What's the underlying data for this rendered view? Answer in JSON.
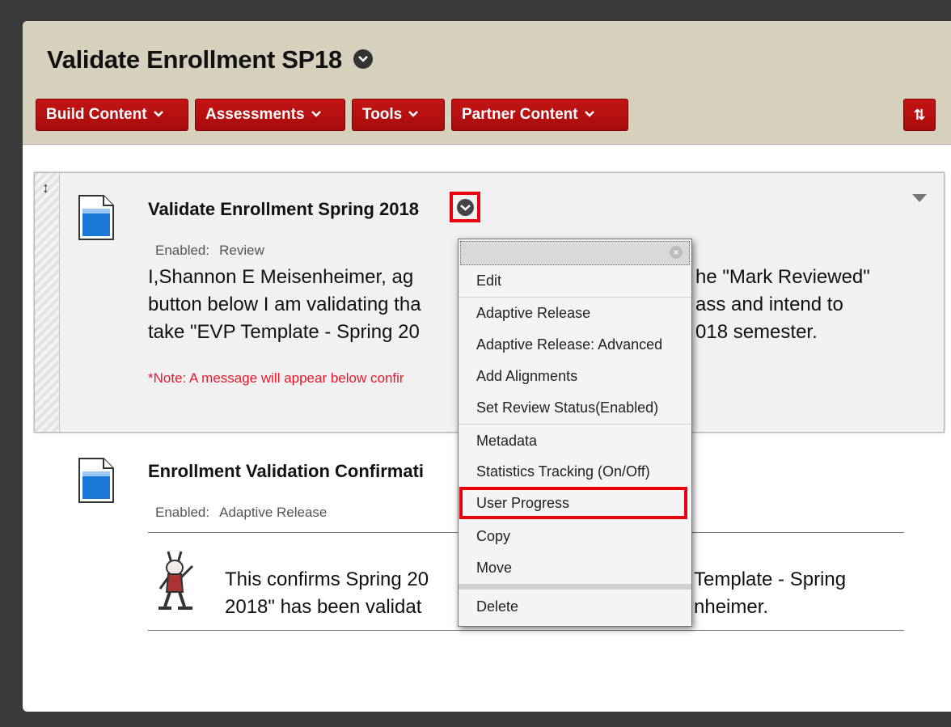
{
  "course": {
    "title": "Validate Enrollment SP18"
  },
  "toolbar": {
    "buttons": [
      {
        "label": "Build Content"
      },
      {
        "label": "Assessments"
      },
      {
        "label": "Tools"
      },
      {
        "label": "Partner Content"
      }
    ],
    "sort_glyph": "⇅"
  },
  "items": [
    {
      "title": "Validate Enrollment Spring 2018",
      "enabled_label": "Enabled:",
      "enabled_value": "Review",
      "body_lines": [
        "I,Shannon E Meisenheimer, ag",
        "button below I am validating tha",
        "take \"EVP Template - Spring 20"
      ],
      "body_lines_right": [
        "he \"Mark Reviewed\"",
        "ass and intend to",
        "018 semester."
      ],
      "note": "*Note: A message will appear below confir"
    },
    {
      "title": "Enrollment Validation Confirmati",
      "enabled_label": "Enabled:",
      "enabled_value": "Adaptive Release",
      "body_lines": [
        "This confirms Spring 20",
        "2018\" has been validat"
      ],
      "body_lines_right": [
        "Template - Spring",
        "nheimer."
      ]
    }
  ],
  "context_menu": {
    "close_glyph": "×",
    "items": [
      "Edit",
      "Adaptive Release",
      "Adaptive Release: Advanced",
      "Add Alignments",
      "Set Review Status(Enabled)",
      "Metadata",
      "Statistics Tracking (On/Off)",
      "User Progress",
      "Copy",
      "Move",
      "Delete"
    ]
  },
  "colors": {
    "header_bg": "#d6d0bd",
    "button_red": "#b20f0f",
    "highlight_red": "#e8000b",
    "note_red": "#e8182b"
  },
  "icons": {
    "document": "document-icon",
    "mascot": "mascot-image",
    "drag": "drag-handle-icon"
  }
}
